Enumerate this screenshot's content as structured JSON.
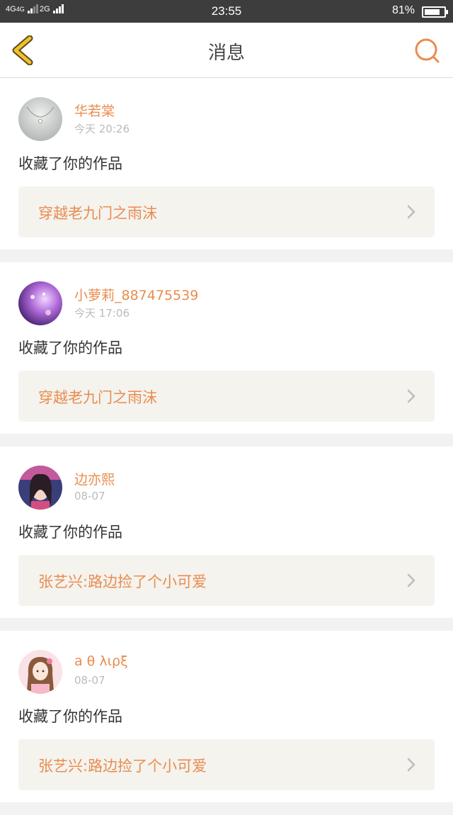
{
  "status_bar": {
    "signal1": "4G",
    "signal1b": "4G",
    "signal2": "2G",
    "time": "23:55",
    "battery": "81%",
    "battery_level": 0.81
  },
  "header": {
    "title": "消息"
  },
  "messages": [
    {
      "name": "华若棠",
      "time": "今天 20:26",
      "action": "收藏了你的作品",
      "work": "穿越老九门之雨沫",
      "avatar": "necklace-photo"
    },
    {
      "name": "小萝莉_887475539",
      "time": "今天 17:06",
      "action": "收藏了你的作品",
      "work": "穿越老九门之雨沫",
      "avatar": "purple-galaxy"
    },
    {
      "name": "边亦熙",
      "time": "08-07",
      "action": "收藏了你的作品",
      "work": "张艺兴:路边捡了个小可爱",
      "avatar": "girl-portrait"
    },
    {
      "name": "a θ λιρξ",
      "time": "08-07",
      "action": "收藏了你的作品",
      "work": "张艺兴:路边捡了个小可爱",
      "avatar": "cartoon-girl"
    }
  ],
  "colors": {
    "accent": "#ea8c4f",
    "back_arrow": "#f2c12e",
    "status_bar": "#3d3d3d",
    "card_bg": "#f4f3ee"
  }
}
